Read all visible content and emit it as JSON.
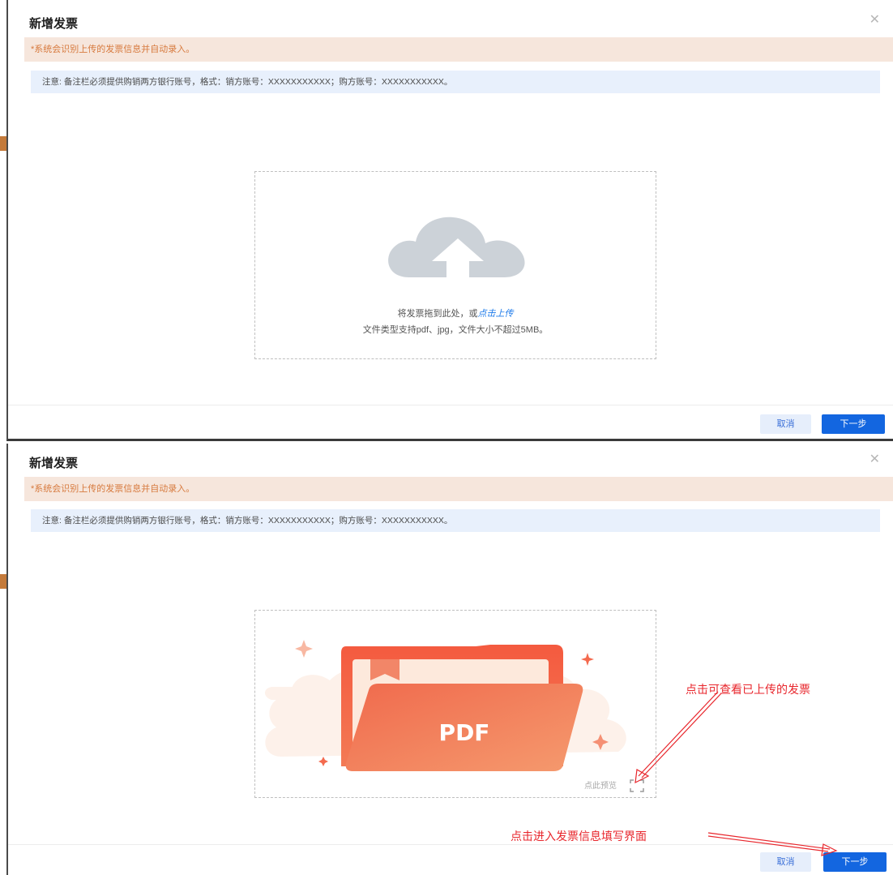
{
  "colors": {
    "primary": "#1366e0",
    "warning_bg": "#f6e6dc",
    "warning_text": "#d77a3e",
    "info_bg": "#e8f0fc",
    "annotation": "#e8262c"
  },
  "dialog": {
    "title": "新增发票",
    "close_icon": "close-icon",
    "notice": "*系统会识别上传的发票信息并自动录入。",
    "info": "注意: 备注栏必须提供购销两方银行账号，格式：销方账号：XXXXXXXXXXX；购方账号：XXXXXXXXXXX。",
    "cancel_label": "取消",
    "next_label": "下一步"
  },
  "upload": {
    "icon": "cloud-upload-icon",
    "drag_text": "将发票拖到此处，或",
    "link_text": "点击上传",
    "hint": "文件类型支持pdf、jpg，文件大小不超过5MB。"
  },
  "uploaded": {
    "file_badge": "PDF",
    "preview_label": "点此预览",
    "preview_icon": "fullscreen-icon"
  },
  "annotations": {
    "preview_note": "点击可查看已上传的发票",
    "next_note": "点击进入发票信息填写界面"
  }
}
